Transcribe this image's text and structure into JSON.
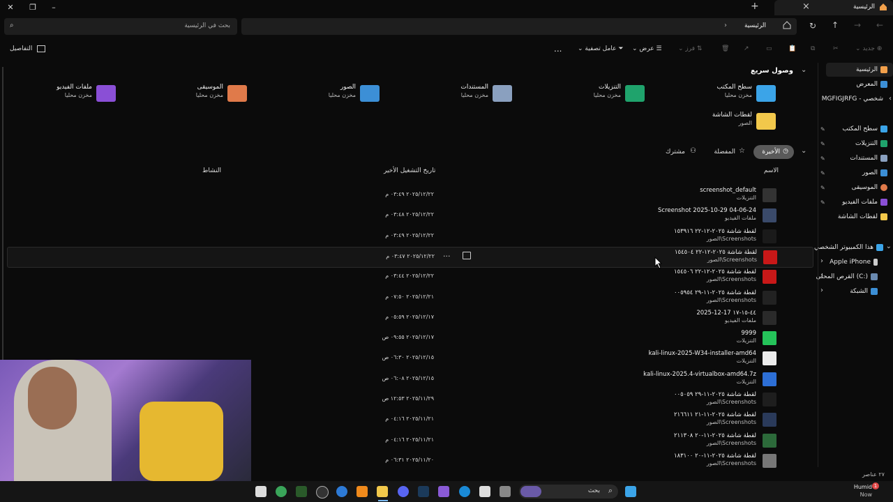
{
  "window": {
    "tab_title": "الرئيسية",
    "new_tab": "+",
    "close_tab": "×"
  },
  "address": {
    "breadcrumb": "الرئيسية",
    "search_placeholder": "بحث في الرئيسية"
  },
  "toolbar": {
    "new_label": "جديد",
    "sort_label": "فرز",
    "view_label": "عرض",
    "filter_label": "عامل تصفية",
    "more": "...",
    "details_label": "التفاصيل"
  },
  "nav": {
    "home": "الرئيسية",
    "gallery": "المعرض",
    "user": "MGFIGJRFG - شخصي",
    "pinned": [
      "سطح المكتب",
      "التنزيلات",
      "المستندات",
      "الصور",
      "الموسيقى",
      "ملفات الفيديو",
      "لقطات الشاشة"
    ],
    "this_pc": "هذا الكمبيوتر الشخصي",
    "iphone": "Apple iPhone",
    "local_disk": "القرص المحلي (C:)",
    "network": "الشبكة"
  },
  "quick_access": {
    "title": "وصول سريع",
    "items": [
      {
        "name": "سطح المكتب",
        "sub": "مخزن محليا",
        "color": "#3ba4e8"
      },
      {
        "name": "التنزيلات",
        "sub": "مخزن محليا",
        "color": "#1fa36c"
      },
      {
        "name": "المستندات",
        "sub": "مخزن محليا",
        "color": "#8aa0bf"
      },
      {
        "name": "الصور",
        "sub": "مخزن محليا",
        "color": "#3c8fd6"
      },
      {
        "name": "الموسيقى",
        "sub": "مخزن محليا",
        "color": "#e07a4a"
      },
      {
        "name": "ملفات الفيديو",
        "sub": "مخزن محليا",
        "color": "#8a4fd6"
      },
      {
        "name": "لقطات الشاشة",
        "sub": "الصور",
        "color": "#f2c84b"
      }
    ]
  },
  "filter_tabs": {
    "recent": "الأخيرة",
    "favorites": "المفضلة",
    "shared": "مشترك"
  },
  "columns": {
    "name": "الاسم",
    "last_opened": "تاريخ التشغيل الأخير",
    "activity": "النشاط"
  },
  "files": [
    {
      "name": "screenshot_default",
      "loc": "التنزيلات",
      "date": "٢٠٢٥/١٢/٢٢ ٠٣:٤٩ م",
      "thumb": "#333"
    },
    {
      "name": "Screenshot 2025-10-29 04-06-24",
      "loc": "ملفات الفيديو",
      "date": "٢٠٢٥/١٢/٢٢ ٠٣:٤٨ م",
      "thumb": "#3a4a6a"
    },
    {
      "name": "لقطة شاشة ٢٠٢٥-١٢-٢٢ ١٥٣٩١٦",
      "loc": "الصور\\Screenshots",
      "date": "٢٠٢٥/١٢/٢٢ ٠٣:٤٩ م",
      "thumb": "#1a1a1a"
    },
    {
      "name": "لقطة شاشة ٢٠٢٥-١٢-٢٢ ١٥٤٥٠٤",
      "loc": "الصور\\Screenshots",
      "date": "٢٠٢٥/١٢/٢٢ ٠٣:٤٧ م",
      "thumb": "#c81818"
    },
    {
      "name": "لقطة شاشة ٢٠٢٥-١٢-٢٢ ١٥٤٥٠٦",
      "loc": "الصور\\Screenshots",
      "date": "٢٠٢٥/١٢/٢٢ ٠٣:٤٤ م",
      "thumb": "#c81818"
    },
    {
      "name": "لقطة شاشة ٢٠٢٥-١١-٢٩ ٠٠٥٩٥٤",
      "loc": "الصور\\Screenshots",
      "date": "٢٠٢٥/١٢/٢١ ٠٧:٥٠ م",
      "thumb": "#222"
    },
    {
      "name": "2025-12-17 ٤٤-١٥-١٧",
      "loc": "ملفات الفيديو",
      "date": "٢٠٢٥/١٢/١٧ ٠٥:٥٩ م",
      "thumb": "#2a2a2a"
    },
    {
      "name": "9999",
      "loc": "التنزيلات",
      "date": "٢٠٢٥/١٢/١٧ ٠٩:٥٥ ص",
      "thumb": "#25c35a"
    },
    {
      "name": "kali-linux-2025-W34-installer-amd64",
      "loc": "التنزيلات",
      "date": "٢٠٢٥/١٢/١٥ ٠٦:٣٠ ص",
      "thumb": "#ececec"
    },
    {
      "name": "kali-linux-2025.4-virtualbox-amd64.7z",
      "loc": "التنزيلات",
      "date": "٢٠٢٥/١٢/١٥ ٠٦:٠٨ ص",
      "thumb": "#2d6fd6"
    },
    {
      "name": "لقطة شاشة ٢٠٢٥-١١-٢٩ ٠٠٥٠٥٩",
      "loc": "الصور\\Screenshots",
      "date": "٢٠٢٥/١١/٢٩ ١٢:٥٣ ص",
      "thumb": "#1e1e1e"
    },
    {
      "name": "لقطة شاشة ٢٠٢٥-١١-٢١ ٢١٦٦١١",
      "loc": "الصور\\Screenshots",
      "date": "٢٠٢٥/١١/٢١ ٠٤:١٦ م",
      "thumb": "#2a3a5a"
    },
    {
      "name": "لقطة شاشة ٢٠٢٥-١١-٢٠ ٢١١٣٠٨",
      "loc": "الصور\\Screenshots",
      "date": "٢٠٢٥/١١/٢١ ٠٤:١٦ م",
      "thumb": "#2c6a3a"
    },
    {
      "name": "لقطة شاشة ٢٠٢٥-١١-٢٠ ١٨٣١٠٠",
      "loc": "الصور\\Screenshots",
      "date": "٢٠٢٥/١١/٢٠ ٠٦:٣١ م",
      "thumb": "#777"
    }
  ],
  "status": {
    "count": "٢٧ عناصر"
  },
  "taskbar": {
    "search_label": "بحث",
    "weather_city": "Humid",
    "weather_time": "Now",
    "badge": "1",
    "icons": [
      "widgets-icon",
      "chrome-icon",
      "terminal-icon",
      "obs-icon",
      "chrome-alt-icon",
      "vlc-icon",
      "folder-icon",
      "discord-icon",
      "steam-icon",
      "app-icon",
      "edge-icon",
      "store-icon",
      "taskview-icon"
    ]
  }
}
